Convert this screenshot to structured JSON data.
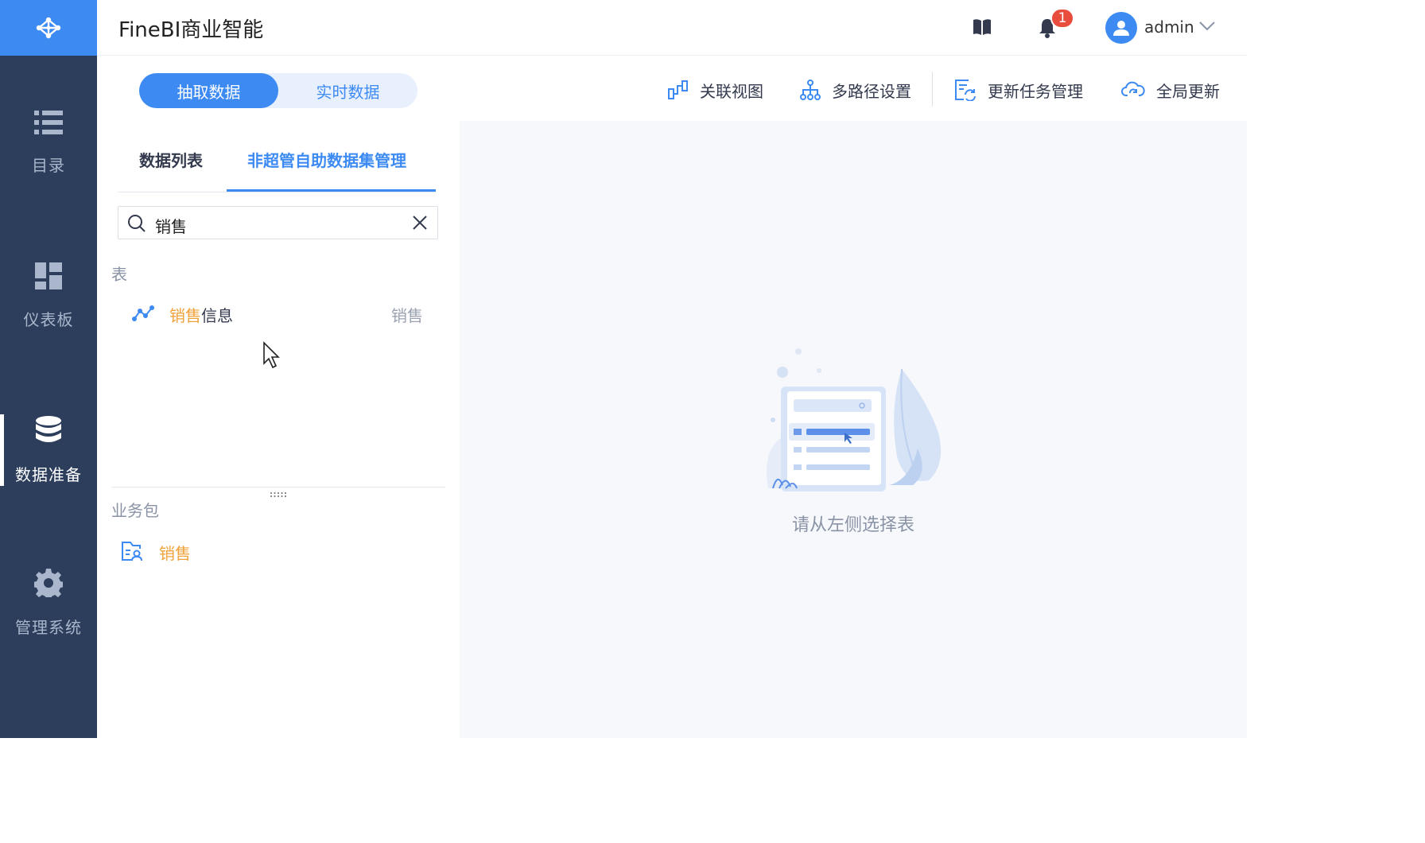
{
  "nav": {
    "items": [
      {
        "label": "目录",
        "icon": "list-icon",
        "active": false
      },
      {
        "label": "仪表板",
        "icon": "dashboard-icon",
        "active": false
      },
      {
        "label": "数据准备",
        "icon": "database-icon",
        "active": true
      },
      {
        "label": "管理系统",
        "icon": "gear-icon",
        "active": false
      }
    ]
  },
  "header": {
    "title": "FineBI商业智能",
    "notification_count": "1",
    "user": "admin"
  },
  "toolbar": {
    "mode_options": [
      "抽取数据",
      "实时数据"
    ],
    "selected_mode": "抽取数据",
    "actions": [
      "关联视图",
      "多路径设置",
      "更新任务管理",
      "全局更新"
    ]
  },
  "left_panel": {
    "tabs": [
      "数据列表",
      "非超管自助数据集管理"
    ],
    "active_tab": "非超管自助数据集管理",
    "search_value": "销售",
    "tables_section": "表",
    "table_result": {
      "highlight": "销售",
      "rest": "信息",
      "tag": "销售"
    },
    "package_section": "业务包",
    "package_result": {
      "highlight": "销售"
    }
  },
  "content": {
    "empty_message": "请从左侧选择表"
  },
  "colors": {
    "accent": "#3d8bf2",
    "nav_bg": "#2c3e5c",
    "highlight": "#f0a23a",
    "badge": "#e84c3d"
  }
}
